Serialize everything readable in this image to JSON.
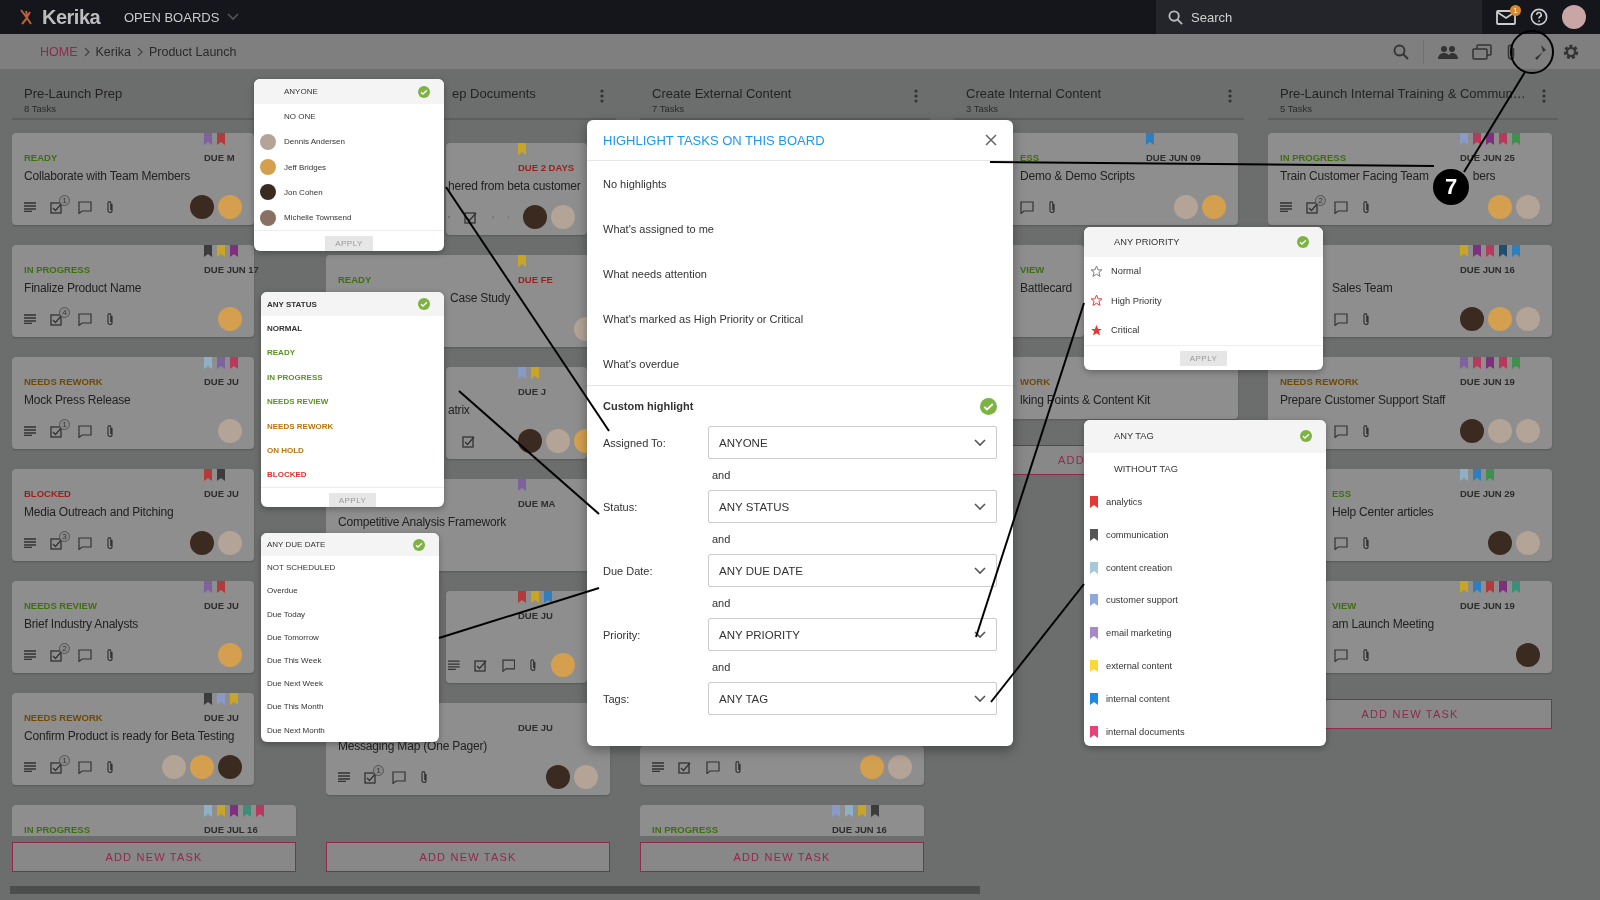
{
  "topbar": {
    "logo": "Kerika",
    "boards_menu": "OPEN BOARDS",
    "search": {
      "placeholder": "Search"
    },
    "mail_badge": "1"
  },
  "breadcrumb": [
    "HOME",
    "Kerika",
    "Product Launch"
  ],
  "columns": [
    {
      "title": "Pre-Launch Prep",
      "count": "8 Tasks",
      "add_button": "ADD NEW TASK",
      "cards": [
        {
          "tags": [
            {
              "color": "#7e62a0"
            },
            {
              "color": "#b23a3a"
            }
          ],
          "status": {
            "text": "READY",
            "color": "#3f6e12"
          },
          "due": {
            "text": "DUE M",
            "color": "#2e2e2e"
          },
          "title": "Collaborate with Team Members",
          "checklist": "1",
          "avatars": [
            {
              "color": "#3b2a20"
            },
            {
              "color": "#d4a050"
            }
          ]
        },
        {
          "tags": [
            {
              "color": "#3c3c3c"
            },
            {
              "color": "#c7a526"
            },
            {
              "color": "#7e2f7e"
            }
          ],
          "status": {
            "text": "IN PROGRESS",
            "color": "#3f6e12"
          },
          "due": {
            "text": "DUE JUN 17",
            "color": "#2e2e2e"
          },
          "title": "Finalize Product Name",
          "checklist": "4",
          "avatars": [
            {
              "color": "#d4a050"
            }
          ]
        },
        {
          "tags": [
            {
              "color": "#8fb0c4"
            },
            {
              "color": "#7e62a0"
            },
            {
              "color": "#b8395e"
            }
          ],
          "status": {
            "text": "NEEDS REWORK",
            "color": "#6e4a08"
          },
          "due": {
            "text": "DUE JU",
            "color": "#2e2e2e"
          },
          "title": "Mock Press Release",
          "checklist": "1",
          "avatars": [
            {
              "color": "#b3a497"
            }
          ]
        },
        {
          "tags": [
            {
              "color": "#b23a3a"
            },
            {
              "color": "#3c3c3c"
            }
          ],
          "status": {
            "text": "BLOCKED",
            "color": "#9b1f1a"
          },
          "due": {
            "text": "DUE JU",
            "color": "#2e2e2e"
          },
          "title": "Media Outreach and Pitching",
          "checklist": "3",
          "avatars": [
            {
              "color": "#3b2a20"
            },
            {
              "color": "#b3a497"
            }
          ]
        },
        {
          "tags": [
            {
              "color": "#7e62a0"
            },
            {
              "color": "#b23a3a"
            }
          ],
          "status": {
            "text": "NEEDS REVIEW",
            "color": "#3f6e12"
          },
          "due": {
            "text": "DUE JU",
            "color": "#2e2e2e"
          },
          "title": "Brief Industry Analysts",
          "checklist": "2",
          "avatars": [
            {
              "color": "#d4a050"
            }
          ]
        },
        {
          "tags": [
            {
              "color": "#3c3c3c"
            },
            {
              "color": "#8a9ac6"
            },
            {
              "color": "#c7a526"
            }
          ],
          "status": {
            "text": "NEEDS REWORK",
            "color": "#6e4a08"
          },
          "due": {
            "text": "DUE JU",
            "color": "#2e2e2e"
          },
          "title": "Confirm Product is ready for Beta Testing",
          "checklist": "1",
          "avatars": [
            {
              "color": "#b3a497"
            },
            {
              "color": "#d4a050"
            },
            {
              "color": "#3b2a20"
            }
          ]
        },
        {
          "tags": [
            {
              "color": "#8fb0c4"
            },
            {
              "color": "#c7a526"
            },
            {
              "color": "#7e2f7e"
            },
            {
              "color": "#3b8f7a"
            },
            {
              "color": "#b8395e"
            }
          ],
          "status": {
            "text": "IN PROGRESS",
            "color": "#3f6e12"
          },
          "due": {
            "text": "DUE JUL 16",
            "color": "#2e2e2e"
          }
        }
      ]
    },
    {
      "title": "ep Documents",
      "add_button": "ADD NEW TASK",
      "cards": [
        {
          "tags": [
            {
              "color": "#c7a526"
            }
          ],
          "due": {
            "text": "DUE 2 DAYS",
            "color": "#9b1f1a"
          },
          "title": "hered from beta customer",
          "avatars": [
            {
              "color": "#3b2a20"
            },
            {
              "color": "#b3a497"
            }
          ]
        },
        {
          "tags": [
            {
              "color": "#c7a526"
            }
          ],
          "status": {
            "text": "READY",
            "color": "#3f6e12"
          },
          "due": {
            "text": "DUE FE",
            "color": "#9b1f1a"
          },
          "title": "Case Study",
          "avatars": [
            {
              "color": "#b3a497"
            }
          ]
        },
        {
          "tags": [
            {
              "color": "#8a9ac6"
            },
            {
              "color": "#c7a526"
            }
          ],
          "due": {
            "text": "DUE J",
            "color": "#2e2e2e"
          },
          "title": "atrix",
          "avatars": [
            {
              "color": "#3b2a20"
            },
            {
              "color": "#b3a497"
            },
            {
              "color": "#d4a050"
            }
          ]
        },
        {
          "tags": [
            {
              "color": "#7e62a0"
            }
          ],
          "due": {
            "text": "DUE MA",
            "color": "#2e2e2e"
          },
          "title": "Competitive Analysis Framework"
        },
        {
          "tags": [
            {
              "color": "#b23a3a"
            },
            {
              "color": "#c7a526"
            },
            {
              "color": "#2d7fc0"
            }
          ],
          "due": {
            "text": "DUE JU",
            "color": "#2e2e2e"
          },
          "avatars": [
            {
              "color": "#d4a050"
            }
          ]
        },
        {
          "due": {
            "text": "DUE JU",
            "color": "#2e2e2e"
          },
          "title": "Messaging Map (One Pager)",
          "checklist": "1",
          "avatars": [
            {
              "color": "#3b2a20"
            },
            {
              "color": "#b3a497"
            }
          ]
        }
      ]
    },
    {
      "title": "Create External Content",
      "count": "7 Tasks",
      "add_button": "ADD NEW TASK",
      "cards": [
        {
          "avatars": [
            {
              "color": "#d4a050"
            },
            {
              "color": "#b3a497"
            }
          ]
        },
        {
          "tags": [
            {
              "color": "#8a9ac6"
            },
            {
              "color": "#8fb0c4"
            },
            {
              "color": "#c7a526"
            },
            {
              "color": "#3c3c3c"
            }
          ],
          "status": {
            "text": "IN PROGRESS",
            "color": "#3f6e12"
          },
          "due": {
            "text": "DUE JUN 16",
            "color": "#2e2e2e"
          }
        }
      ]
    },
    {
      "title": "Create Internal Content",
      "count": "3 Tasks",
      "add_button": "ADD",
      "cards": [
        {
          "tags": [
            {
              "color": "#2d7fc0"
            }
          ],
          "status": {
            "text": "ESS",
            "color": "#3f6e12"
          },
          "due": {
            "text": "DUE JUN 09",
            "color": "#2e2e2e"
          },
          "title": "Demo & Demo Scripts",
          "avatars": [
            {
              "color": "#b3a497"
            },
            {
              "color": "#d4a050"
            }
          ]
        },
        {
          "status": {
            "text": "VIEW",
            "color": "#3f6e12"
          },
          "title": "Battlecard"
        },
        {
          "status": {
            "text": "WORK",
            "color": "#6e4a08"
          },
          "title": "lking Points & Content Kit"
        }
      ]
    },
    {
      "title": "Pre-Launch Internal Training & Commun…",
      "count": "5 Tasks",
      "add_button": "ADD NEW TASK",
      "cards": [
        {
          "tags": [
            {
              "color": "#8a9ac6"
            },
            {
              "color": "#b8395e"
            },
            {
              "color": "#7e2f7e"
            },
            {
              "color": "#b8395e"
            },
            {
              "color": "#3f8f4f"
            }
          ],
          "status": {
            "text": "IN PROGRESS",
            "color": "#3f6e12"
          },
          "due": {
            "text": "DUE JUN 25",
            "color": "#2e2e2e"
          },
          "title": "Train Customer Facing Team",
          "title_end": "bers",
          "checklist": "2",
          "avatars": [
            {
              "color": "#d4a050"
            },
            {
              "color": "#b3a497"
            }
          ]
        },
        {
          "tags": [
            {
              "color": "#c7a526"
            },
            {
              "color": "#7e2f7e"
            },
            {
              "color": "#b8395e"
            },
            {
              "color": "#1f4e6e"
            },
            {
              "color": "#2d7fc0"
            }
          ],
          "due": {
            "text": "DUE JUN 16",
            "color": "#2e2e2e"
          },
          "title": "Sales Team",
          "avatars": [
            {
              "color": "#3b2a20"
            },
            {
              "color": "#d4a050"
            },
            {
              "color": "#b3a497"
            }
          ]
        },
        {
          "tags": [
            {
              "color": "#7e62a0"
            },
            {
              "color": "#b8395e"
            },
            {
              "color": "#7e2f7e"
            },
            {
              "color": "#b8395e"
            },
            {
              "color": "#3f8f4f"
            }
          ],
          "status": {
            "text": "NEEDS REWORK",
            "color": "#6e4a08"
          },
          "due": {
            "text": "DUE JUN 19",
            "color": "#2e2e2e"
          },
          "title": "Prepare Customer Support Staff",
          "avatars": [
            {
              "color": "#3b2a20"
            },
            {
              "color": "#b3a497"
            },
            {
              "color": "#b3a497"
            }
          ]
        },
        {
          "tags": [
            {
              "color": "#8fb0c4"
            },
            {
              "color": "#2d7fc0"
            },
            {
              "color": "#3f8f4f"
            }
          ],
          "status": {
            "text": "ESS",
            "color": "#3f6e12"
          },
          "due": {
            "text": "DUE JUN 29",
            "color": "#2e2e2e"
          },
          "title": "Help Center articles",
          "avatars": [
            {
              "color": "#3b2a20"
            },
            {
              "color": "#b3a497"
            }
          ]
        },
        {
          "tags": [
            {
              "color": "#c7a526"
            },
            {
              "color": "#2d7fc0"
            },
            {
              "color": "#b23a3a"
            },
            {
              "color": "#7e2f7e"
            },
            {
              "color": "#3b8f7a"
            }
          ],
          "status": {
            "text": "VIEW",
            "color": "#3f6e12"
          },
          "due": {
            "text": "DUE JUN 19",
            "color": "#2e2e2e"
          },
          "title": "am Launch Meeting",
          "avatars": [
            {
              "color": "#3b2a20"
            }
          ]
        }
      ]
    }
  ],
  "highlight_dialog": {
    "title": "HIGHLIGHT TASKS ON THIS BOARD",
    "options": [
      {
        "label": "No highlights",
        "selected": false
      },
      {
        "label": "What's assigned to me",
        "selected": false
      },
      {
        "label": "What needs attention",
        "selected": false
      },
      {
        "label": "What's marked as High Priority or Critical",
        "selected": false
      },
      {
        "label": "What's overdue",
        "selected": false
      }
    ],
    "custom": {
      "label": "Custom highlight",
      "selected": true
    },
    "filters": [
      {
        "label": "Assigned To:",
        "value": "ANYONE",
        "joiner": "and"
      },
      {
        "label": "Status:",
        "value": "ANY STATUS",
        "joiner": "and"
      },
      {
        "label": "Due Date:",
        "value": "ANY DUE DATE",
        "joiner": "and"
      },
      {
        "label": "Priority:",
        "value": "ANY PRIORITY",
        "joiner": "and"
      },
      {
        "label": "Tags:",
        "value": "ANY TAG"
      }
    ]
  },
  "assignee_menu": {
    "apply": "APPLY",
    "items": [
      {
        "label": "ANYONE",
        "kind": "option",
        "selected": true
      },
      {
        "label": "NO ONE",
        "kind": "option",
        "selected": false
      },
      {
        "label": "Dennis Andersen",
        "kind": "person",
        "color": "#b3a497",
        "selected": false
      },
      {
        "label": "Jeff Bridges",
        "kind": "person",
        "color": "#d4a050",
        "selected": false
      },
      {
        "label": "Jon Cohen",
        "kind": "person",
        "color": "#3b2a20",
        "selected": false
      },
      {
        "label": "Michelle Townsend",
        "kind": "person",
        "color": "#8a7060",
        "selected": false
      }
    ]
  },
  "status_menu": {
    "apply": "APPLY",
    "items": [
      {
        "label": "ANY STATUS",
        "color": "#333333",
        "selected": true
      },
      {
        "label": "NORMAL",
        "color": "#333333",
        "selected": false
      },
      {
        "label": "READY",
        "color": "#5a9420",
        "selected": false
      },
      {
        "label": "IN PROGRESS",
        "color": "#5a9420",
        "selected": false
      },
      {
        "label": "NEEDS REVIEW",
        "color": "#5a9420",
        "selected": false
      },
      {
        "label": "NEEDS REWORK",
        "color": "#bb740c",
        "selected": false
      },
      {
        "label": "ON HOLD",
        "color": "#bb740c",
        "selected": false
      },
      {
        "label": "BLOCKED",
        "color": "#e0302b",
        "selected": false
      }
    ]
  },
  "due_menu": {
    "items": [
      {
        "label": "ANY DUE DATE",
        "selected": true
      },
      {
        "label": "NOT SCHEDULED",
        "selected": false
      },
      {
        "label": "Overdue",
        "selected": false
      },
      {
        "label": "Due Today",
        "selected": false
      },
      {
        "label": "Due Tomorrow",
        "selected": false
      },
      {
        "label": "Due This Week",
        "selected": false
      },
      {
        "label": "Due Next Week",
        "selected": false
      },
      {
        "label": "Due This Month",
        "selected": false
      },
      {
        "label": "Due Next Month",
        "selected": false
      }
    ]
  },
  "priority_menu": {
    "apply": "APPLY",
    "items": [
      {
        "label": "ANY PRIORITY",
        "kind": "any",
        "selected": true
      },
      {
        "label": "Normal",
        "kind": "normal",
        "selected": false
      },
      {
        "label": "High Priority",
        "kind": "high",
        "selected": false
      },
      {
        "label": "Critical",
        "kind": "critical",
        "selected": false
      }
    ]
  },
  "tag_menu": {
    "items": [
      {
        "label": "ANY TAG",
        "kind": "option",
        "selected": true
      },
      {
        "label": "WITHOUT TAG",
        "kind": "option",
        "selected": false
      },
      {
        "label": "analytics",
        "kind": "tag",
        "color": "#e53935",
        "selected": false
      },
      {
        "label": "communication",
        "kind": "tag",
        "color": "#555555",
        "selected": false
      },
      {
        "label": "content creation",
        "kind": "tag",
        "color": "#a8c8d8",
        "selected": false
      },
      {
        "label": "customer support",
        "kind": "tag",
        "color": "#8fa8d8",
        "selected": false
      },
      {
        "label": "email marketing",
        "kind": "tag",
        "color": "#a888c8",
        "selected": false
      },
      {
        "label": "external content",
        "kind": "tag",
        "color": "#fdd835",
        "selected": false
      },
      {
        "label": "internal content",
        "kind": "tag",
        "color": "#1e88e5",
        "selected": false
      },
      {
        "label": "internal documents",
        "kind": "tag",
        "color": "#ec407a",
        "selected": false
      }
    ]
  },
  "callout": {
    "label": "7"
  }
}
